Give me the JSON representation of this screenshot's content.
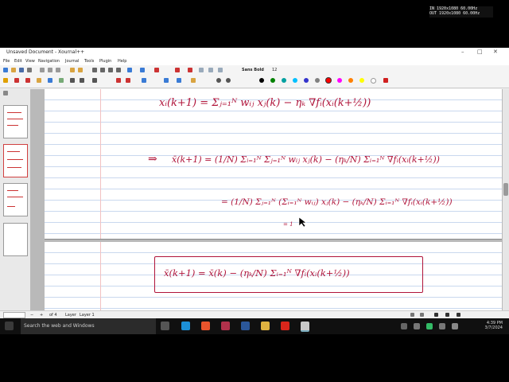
{
  "window": {
    "title": "Unsaved Document - Xournal++",
    "controls": [
      "–",
      "□",
      "✕"
    ]
  },
  "overlay": {
    "line1": "IN 1920x1080 60.00Hz",
    "line2": "OUT 1920x1080 60.00Hz"
  },
  "menu": [
    "File",
    "Edit",
    "View",
    "Navigation",
    "Journal",
    "Tools",
    "Plugin",
    "Help"
  ],
  "toolbar": {
    "font_name": "Sans Bold",
    "font_size": "12",
    "pen_colors": [
      "#000000",
      "#008000",
      "#00a0a0",
      "#00c0ff",
      "#3333cc",
      "#808080",
      "#ff0000",
      "#ff00ff",
      "#ff8000",
      "#ffff00",
      "#ffffff"
    ],
    "icons": [
      "new-icon",
      "open-icon",
      "save-icon",
      "print-icon",
      "cut-icon",
      "copy-icon",
      "paste-icon",
      "undo-icon",
      "redo-icon",
      "first-page-icon",
      "prev-page-icon",
      "next-page-icon",
      "last-page-icon",
      "zoom-icon",
      "fullscreen-icon"
    ]
  },
  "pages": {
    "eq1": "xᵢ(k+1) = Σⱼ₌₁ᴺ wᵢⱼ xⱼ(k) − ηₖ ∇fᵢ(xᵢ(k+½))",
    "eq2_arrow": "⇒",
    "eq2": "x̄(k+1) = (1/N) Σᵢ₌₁ᴺ Σⱼ₌₁ᴺ wᵢⱼ xⱼ(k) − (ηₖ/N) Σᵢ₌₁ᴺ ∇fᵢ(xᵢ(k+½))",
    "eq3": "= (1/N) Σⱼ₌₁ᴺ (Σᵢ₌₁ᴺ wᵢⱼ) xⱼ(k) − (ηₖ/N) Σᵢ₌₁ᴺ ∇fᵢ(xᵢ(k+½))",
    "eq3_note": "= 1",
    "boxed": "x̄(k+1) = x̄(k) − (ηₖ/N) Σᵢ₌₁ᴺ ∇fᵢ(xᵢ(k+½))"
  },
  "status": {
    "page_label": "of 4",
    "layer_label": "Layer 1"
  },
  "taskbar": {
    "search_placeholder": "Search the web and Windows",
    "time": "4:39 PM",
    "date": "3/7/2024"
  }
}
